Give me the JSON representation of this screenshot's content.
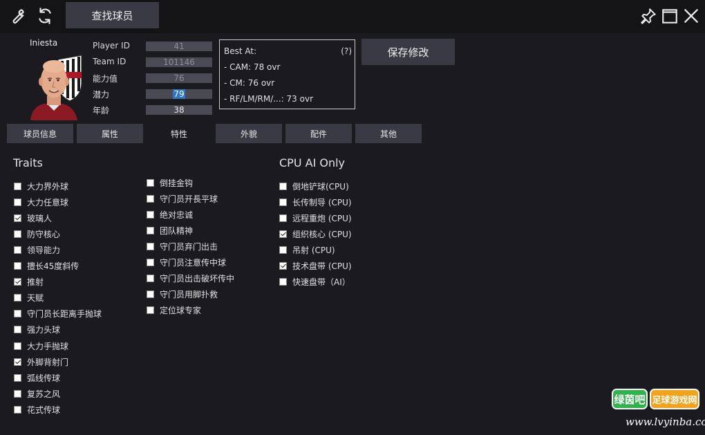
{
  "toolbar": {
    "find_player_label": "查找球员"
  },
  "player": {
    "name": "Iniesta",
    "fields": [
      {
        "label": "Player ID",
        "value": "41"
      },
      {
        "label": "Team ID",
        "value": "101146"
      },
      {
        "label": "能力值",
        "value": "76"
      },
      {
        "label": "潜力",
        "value": "79"
      },
      {
        "label": "年龄",
        "value": "38"
      }
    ],
    "best_at": {
      "title": "Best At:",
      "help": "(?)",
      "lines": [
        "- CAM: 78 ovr",
        "- CM: 76 ovr",
        "- RF/LM/RM/...: 73 ovr"
      ]
    }
  },
  "save_label": "保存修改",
  "tabs": [
    {
      "label": "球员信息",
      "active": false
    },
    {
      "label": "属性",
      "active": false
    },
    {
      "label": "特性",
      "active": true
    },
    {
      "label": "外貌",
      "active": false
    },
    {
      "label": "配件",
      "active": false
    },
    {
      "label": "其他",
      "active": false
    }
  ],
  "traits": {
    "title": "Traits",
    "col1": [
      {
        "label": "大力界外球",
        "checked": false
      },
      {
        "label": "大力任意球",
        "checked": false
      },
      {
        "label": "玻璃人",
        "checked": true
      },
      {
        "label": "防守核心",
        "checked": false
      },
      {
        "label": "领导能力",
        "checked": false
      },
      {
        "label": "擅长45度斜传",
        "checked": false
      },
      {
        "label": "推射",
        "checked": true
      },
      {
        "label": "天赋",
        "checked": false
      },
      {
        "label": "守门员长距离手抛球",
        "checked": false
      },
      {
        "label": "强力头球",
        "checked": false
      },
      {
        "label": "大力手抛球",
        "checked": false
      },
      {
        "label": "外脚背射门",
        "checked": true
      },
      {
        "label": "弧线传球",
        "checked": false
      },
      {
        "label": "复苏之风",
        "checked": false
      },
      {
        "label": "花式传球",
        "checked": false
      }
    ],
    "col2": [
      {
        "label": "倒挂金钩",
        "checked": false
      },
      {
        "label": "守门员开長平球",
        "checked": false
      },
      {
        "label": "绝对忠诚",
        "checked": false
      },
      {
        "label": "团队精神",
        "checked": false
      },
      {
        "label": "守门员弃门出击",
        "checked": false
      },
      {
        "label": "守门员注意传中球",
        "checked": false
      },
      {
        "label": "守门员出击破坏传中",
        "checked": false
      },
      {
        "label": "守门员用脚扑救",
        "checked": false
      },
      {
        "label": "定位球专家",
        "checked": false
      }
    ]
  },
  "cpu_ai": {
    "title": "CPU AI Only",
    "items": [
      {
        "label": "倒地铲球(CPU)",
        "checked": false
      },
      {
        "label": "长传制导 (CPU)",
        "checked": false
      },
      {
        "label": "远程重炮 (CPU)",
        "checked": false
      },
      {
        "label": "组织核心 (CPU)",
        "checked": true
      },
      {
        "label": "吊射 (CPU)",
        "checked": false
      },
      {
        "label": "技术盘带 (CPU)",
        "checked": true
      },
      {
        "label": "快速盘带（AI）",
        "checked": false
      }
    ]
  },
  "watermark": {
    "logo_left": "绿茵吧",
    "logo_right": "足球游戏网",
    "url": "www.lvyinba.com",
    "logo_colors": [
      "#2fb34a",
      "#f3a21b"
    ]
  }
}
